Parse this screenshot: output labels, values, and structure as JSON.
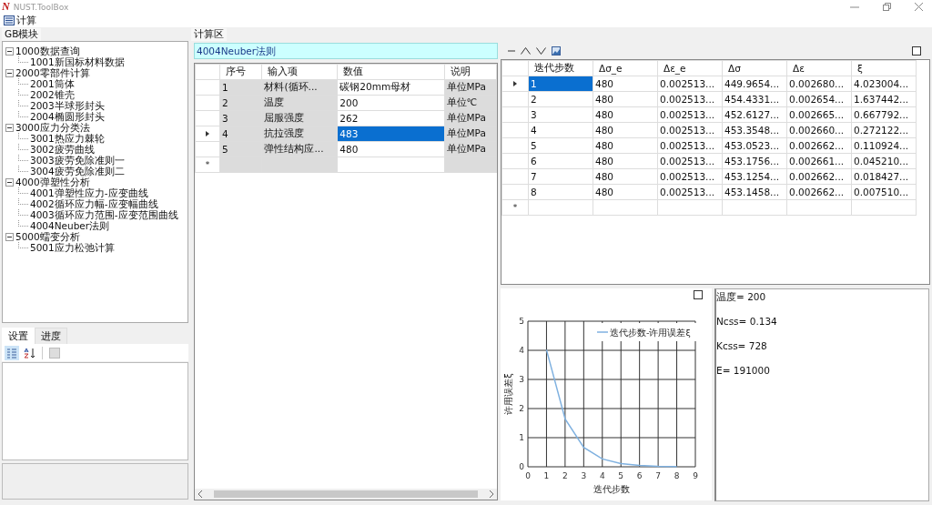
{
  "window": {
    "logo": "N",
    "title": "NUST.ToolBox"
  },
  "menu": [
    {
      "label": "计算"
    }
  ],
  "left_tab": {
    "label": "GB模块",
    "selected": true
  },
  "tree": [
    {
      "label": "1000数据查询",
      "expanded": true,
      "children": [
        {
          "label": "1001新国标材料数据"
        }
      ]
    },
    {
      "label": "2000零部件计算",
      "expanded": true,
      "children": [
        {
          "label": "2001筒体"
        },
        {
          "label": "2002锥壳"
        },
        {
          "label": "2003半球形封头"
        },
        {
          "label": "2004椭圆形封头"
        }
      ]
    },
    {
      "label": "3000应力分类法",
      "expanded": true,
      "children": [
        {
          "label": "3001热应力棘轮"
        },
        {
          "label": "3002疲劳曲线"
        },
        {
          "label": "3003疲劳免除准则一"
        },
        {
          "label": "3004疲劳免除准则二"
        }
      ]
    },
    {
      "label": "4000弹塑性分析",
      "expanded": true,
      "children": [
        {
          "label": "4001弹塑性应力-应变曲线"
        },
        {
          "label": "4002循环应力幅-应变幅曲线"
        },
        {
          "label": "4003循环应力范围-应变范围曲线"
        },
        {
          "label": "4004Neuber法则"
        }
      ]
    },
    {
      "label": "5000蠕变分析",
      "expanded": true,
      "children": [
        {
          "label": "5001应力松弛计算"
        }
      ]
    }
  ],
  "lower_tabs": [
    {
      "label": "设置",
      "selected": true
    },
    {
      "label": "进度",
      "selected": false
    }
  ],
  "property_toolbar": [
    {
      "kind": "categorized",
      "selected": true
    },
    {
      "kind": "alphabetical",
      "selected": false
    },
    {
      "kind": "pages",
      "selected": false
    }
  ],
  "work_tab": {
    "label": "计算区",
    "selected": true
  },
  "module_title": "4004Neuber法则",
  "input_grid": {
    "columns": [
      "序号",
      "输入项",
      "数值",
      "说明"
    ],
    "rows": [
      {
        "selected": false,
        "cells": [
          "1",
          "材料(循环...",
          "碳钢20mm母材",
          "单位MPa"
        ]
      },
      {
        "selected": false,
        "cells": [
          "2",
          "温度",
          "200",
          "单位℃"
        ]
      },
      {
        "selected": false,
        "cells": [
          "3",
          "屈服强度",
          "262",
          "单位MPa"
        ]
      },
      {
        "selected": true,
        "cells": [
          "4",
          "抗拉强度",
          "483",
          "单位MPa"
        ]
      },
      {
        "selected": false,
        "cells": [
          "5",
          "弹性结构应...",
          "480",
          "单位MPa"
        ]
      }
    ],
    "new_row_marker": "*"
  },
  "result_grid": {
    "columns": [
      "迭代步数",
      "Δσ_e",
      "Δε_e",
      "Δσ",
      "Δε",
      "ξ"
    ],
    "rows": [
      {
        "selected": true,
        "cells": [
          "1",
          "480",
          "0.002513...",
          "449.9654...",
          "0.002680...",
          "4.023004..."
        ]
      },
      {
        "selected": false,
        "cells": [
          "2",
          "480",
          "0.002513...",
          "454.4331...",
          "0.002654...",
          "1.637442..."
        ]
      },
      {
        "selected": false,
        "cells": [
          "3",
          "480",
          "0.002513...",
          "452.6127...",
          "0.002665...",
          "0.667792..."
        ]
      },
      {
        "selected": false,
        "cells": [
          "4",
          "480",
          "0.002513...",
          "453.3548...",
          "0.002660...",
          "0.272122..."
        ]
      },
      {
        "selected": false,
        "cells": [
          "5",
          "480",
          "0.002513...",
          "453.0523...",
          "0.002662...",
          "0.110924..."
        ]
      },
      {
        "selected": false,
        "cells": [
          "6",
          "480",
          "0.002513...",
          "453.1756...",
          "0.002661...",
          "0.045210..."
        ]
      },
      {
        "selected": false,
        "cells": [
          "7",
          "480",
          "0.002513...",
          "453.1254...",
          "0.002662...",
          "0.018427..."
        ]
      },
      {
        "selected": false,
        "cells": [
          "8",
          "480",
          "0.002513...",
          "453.1458...",
          "0.002662...",
          "0.007510..."
        ]
      }
    ],
    "new_row_marker": "*"
  },
  "chart_data": {
    "type": "line",
    "xlabel": "迭代步数",
    "ylabel": "许用误差ξ",
    "x": [
      1,
      2,
      3,
      4,
      5,
      6,
      7,
      8
    ],
    "series": [
      {
        "name": "迭代步数-许用误差ξ",
        "color": "#7fb1e0",
        "values": [
          4.02,
          1.64,
          0.67,
          0.27,
          0.11,
          0.05,
          0.02,
          0.01
        ]
      }
    ],
    "grid": true,
    "xlim": [
      0,
      9
    ],
    "ylim": [
      0,
      5
    ],
    "xticks": [
      0,
      1,
      2,
      3,
      4,
      5,
      6,
      7,
      8,
      9
    ],
    "yticks": [
      0,
      1,
      2,
      3,
      4,
      5
    ]
  },
  "results_text": [
    "温度= 200",
    "Ncss= 0.134",
    "Kcss= 728",
    "E= 191000"
  ]
}
